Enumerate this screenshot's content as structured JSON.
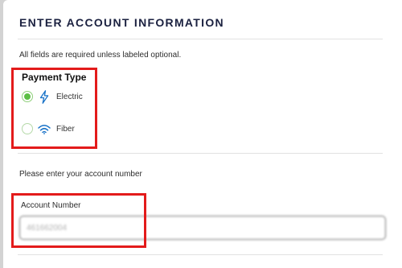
{
  "form": {
    "title": "ENTER ACCOUNT INFORMATION",
    "required_note": "All fields are required unless labeled optional."
  },
  "payment_type": {
    "label": "Payment Type",
    "options": [
      {
        "label": "Electric",
        "icon": "lightning-bolt-icon",
        "selected": true
      },
      {
        "label": "Fiber",
        "icon": "wifi-icon",
        "selected": false
      }
    ]
  },
  "account": {
    "prompt": "Please enter your account number",
    "field_label": "Account Number",
    "field_value": "461662004"
  },
  "colors": {
    "title": "#1b2140",
    "radio_accent": "#5cbf45",
    "icon_blue": "#1a73c8",
    "highlight": "#e31b1b"
  }
}
